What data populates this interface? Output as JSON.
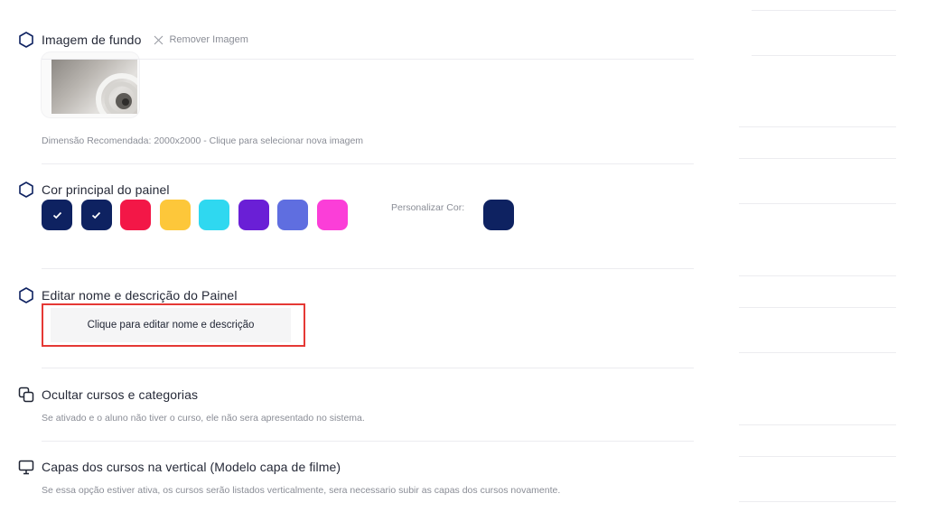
{
  "background_image": {
    "title": "Imagem de fundo",
    "remove_label": "Remover Imagem",
    "help": "Dimensão Recomendada: 2000x2000 - Clique para selecionar nova imagem"
  },
  "main_color": {
    "title": "Cor principal do painel",
    "custom_label": "Personalizar Cor:",
    "swatches": [
      {
        "color": "#0e2261",
        "checked": true
      },
      {
        "color": "#0e2261",
        "checked": true
      },
      {
        "color": "#f31747",
        "checked": false
      },
      {
        "color": "#fdc73a",
        "checked": false
      },
      {
        "color": "#2fd8f0",
        "checked": false
      },
      {
        "color": "#6a1fd6",
        "checked": false
      },
      {
        "color": "#5f6ee0",
        "checked": false
      },
      {
        "color": "#fb3ed8",
        "checked": false
      }
    ],
    "custom_color": "#0e2261"
  },
  "edit_panel": {
    "title": "Editar nome e descrição do Painel",
    "button_label": "Clique para editar nome e descrição"
  },
  "hide_courses": {
    "title": "Ocultar cursos e categorias",
    "help": "Se ativado e o aluno não tiver o curso, ele não sera apresentado no sistema."
  },
  "vertical_covers": {
    "title": "Capas dos cursos na vertical (Modelo capa de filme)",
    "help": "Se essa opção estiver ativa, os cursos serão listados verticalmente, sera necessario subir as capas dos cursos novamente."
  },
  "colors": {
    "accent": "#0e2261",
    "highlight_border": "#e53935"
  }
}
